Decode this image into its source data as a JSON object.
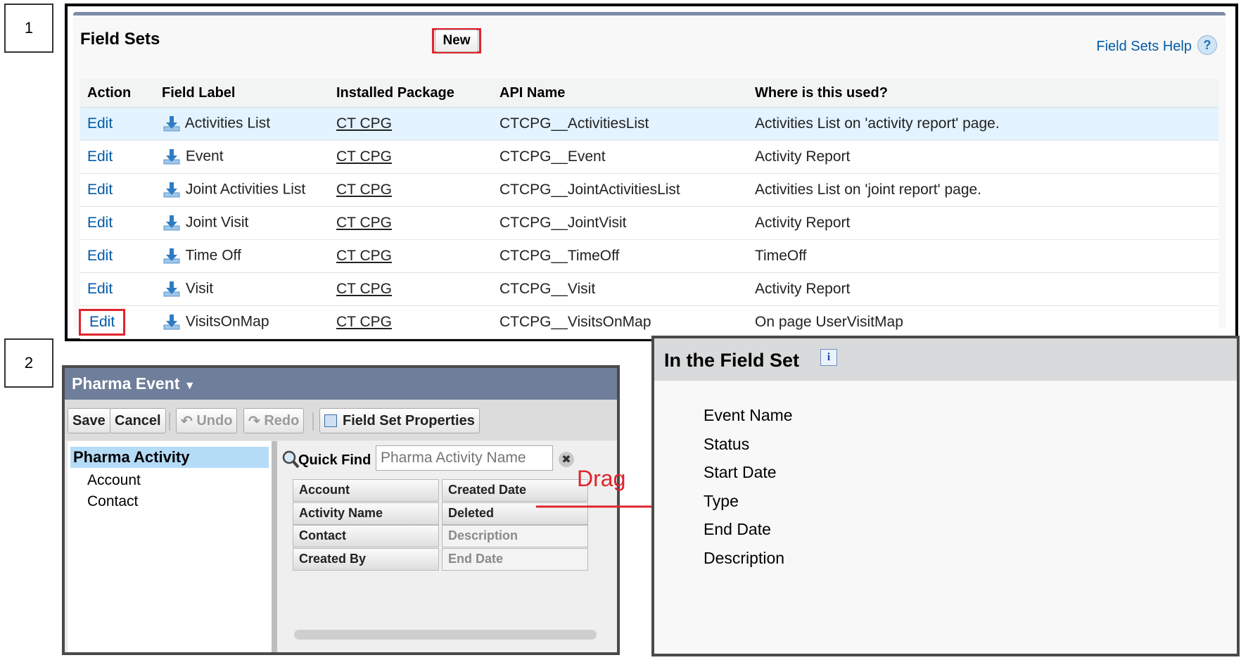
{
  "steps": {
    "one": "1",
    "two": "2"
  },
  "field_sets": {
    "title": "Field Sets",
    "new_button": "New",
    "help_link": "Field Sets Help",
    "help_icon": "?",
    "columns": [
      "Action",
      "Field Label",
      "Installed Package",
      "API Name",
      "Where is this used?"
    ],
    "rows": [
      {
        "action": "Edit",
        "label": "Activities List",
        "package": "CT CPG",
        "api": "CTCPG__ActivitiesList",
        "used": "Activities List on 'activity report' page."
      },
      {
        "action": "Edit",
        "label": "Event",
        "package": "CT CPG",
        "api": "CTCPG__Event",
        "used": "Activity Report"
      },
      {
        "action": "Edit",
        "label": "Joint Activities List",
        "package": "CT CPG",
        "api": "CTCPG__JointActivitiesList",
        "used": "Activities List on 'joint report' page."
      },
      {
        "action": "Edit",
        "label": "Joint Visit",
        "package": "CT CPG",
        "api": "CTCPG__JointVisit",
        "used": "Activity Report"
      },
      {
        "action": "Edit",
        "label": "Time Off",
        "package": "CT CPG",
        "api": "CTCPG__TimeOff",
        "used": "TimeOff"
      },
      {
        "action": "Edit",
        "label": "Visit",
        "package": "CT CPG",
        "api": "CTCPG__Visit",
        "used": "Activity Report"
      },
      {
        "action": "Edit",
        "label": "VisitsOnMap",
        "package": "CT CPG",
        "api": "CTCPG__VisitsOnMap",
        "used": "On page UserVisitMap"
      }
    ]
  },
  "editor": {
    "title": "Pharma Event",
    "toolbar": {
      "save": "Save",
      "cancel": "Cancel",
      "undo": "Undo",
      "redo": "Redo",
      "properties": "Field Set Properties"
    },
    "tree": {
      "selected": "Pharma Activity",
      "items": [
        "Account",
        "Contact"
      ]
    },
    "quick_find": {
      "label": "Quick Find",
      "placeholder": "Pharma Activity Name"
    },
    "fields": [
      [
        "Account",
        "Created Date"
      ],
      [
        "Activity Name",
        "Deleted"
      ],
      [
        "Contact",
        "Description"
      ],
      [
        "Created By",
        "End Date"
      ]
    ]
  },
  "drag_label": "Drag",
  "field_set": {
    "title": "In the Field Set",
    "info_icon": "i",
    "items": [
      "Event Name",
      "Status",
      "Start Date",
      "Type",
      "End Date",
      "Description"
    ]
  },
  "colors": {
    "accent_red": "#e0242c",
    "link_blue": "#015ba7",
    "header_slate": "#6f7e9a",
    "row_highlight": "#e3f3ff"
  }
}
